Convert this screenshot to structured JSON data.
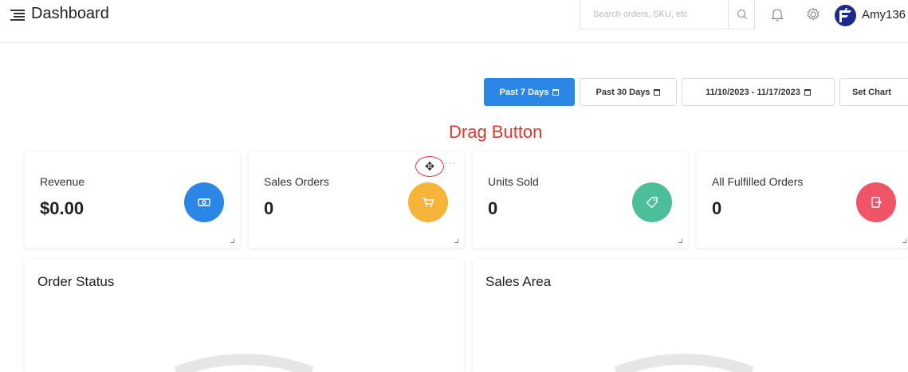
{
  "header": {
    "title": "Dashboard",
    "search_placeholder": "Search orders, SKU, etc",
    "username": "Amy136",
    "icons": [
      "menu-icon",
      "search-icon",
      "bell-icon",
      "gear-icon"
    ]
  },
  "date_range": {
    "buttons": [
      {
        "label": "Past 7 Days",
        "active": true
      },
      {
        "label": "Past 30 Days",
        "active": false
      },
      {
        "label": "11/10/2023 - 11/17/2023",
        "active": false
      }
    ],
    "set_chart_label": "Set Chart"
  },
  "annotation": "Drag Button",
  "stats": [
    {
      "label": "Revenue",
      "value": "$0.00",
      "color": "#2b86e6",
      "icon": "money-icon"
    },
    {
      "label": "Sales Orders",
      "value": "0",
      "color": "#f6b43a",
      "icon": "cart-icon"
    },
    {
      "label": "Units Sold",
      "value": "0",
      "color": "#4cbf9a",
      "icon": "tag-icon"
    },
    {
      "label": "All Fulfilled Orders",
      "value": "0",
      "color": "#ef5566",
      "icon": "exit-icon"
    }
  ],
  "panels": [
    {
      "title": "Order Status"
    },
    {
      "title": "Sales Area"
    }
  ]
}
